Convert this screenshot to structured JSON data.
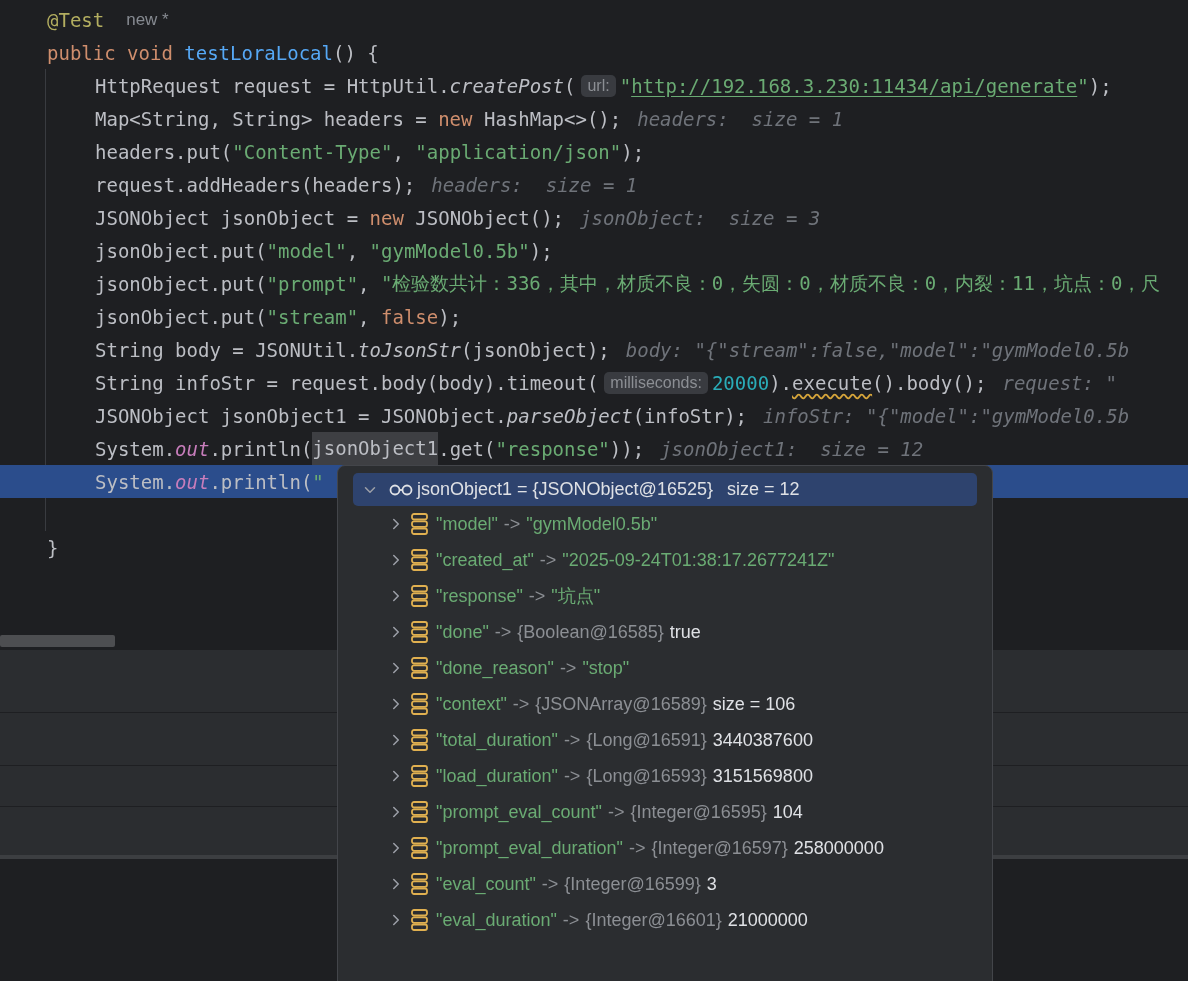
{
  "code": {
    "lines": [
      {
        "current": false,
        "tokens": [
          {
            "text": "@Test",
            "kind": "annotation"
          },
          {
            "text": "new *",
            "kind": "vision"
          }
        ]
      },
      {
        "current": false,
        "tokens": [
          {
            "text": "public void ",
            "kind": "keyword"
          },
          {
            "text": "testLoraLocal",
            "kind": "method"
          },
          {
            "text": "() {",
            "kind": "plain"
          }
        ],
        "children": [
          {
            "current": false,
            "tokens": [
              {
                "text": "HttpRequest request = HttpUtil.",
                "kind": "plain"
              },
              {
                "text": "createPost",
                "kind": "italic"
              },
              {
                "text": "(",
                "kind": "plain"
              },
              {
                "text": "url:",
                "kind": "param"
              },
              {
                "text": "\"",
                "kind": "string"
              },
              {
                "text": "http://192.168.3.230:11434/api/generate",
                "kind": "link"
              },
              {
                "text": "\"",
                "kind": "string"
              },
              {
                "text": ");",
                "kind": "plain"
              }
            ]
          },
          {
            "current": false,
            "tokens": [
              {
                "text": "Map<String, String> headers = ",
                "kind": "plain"
              },
              {
                "text": "new",
                "kind": "keyword"
              },
              {
                "text": " HashMap<>();",
                "kind": "plain"
              },
              {
                "text": "headers:  size = 1",
                "kind": "hint"
              }
            ]
          },
          {
            "current": false,
            "tokens": [
              {
                "text": "headers.put(",
                "kind": "plain"
              },
              {
                "text": "\"Content-Type\"",
                "kind": "string"
              },
              {
                "text": ", ",
                "kind": "plain"
              },
              {
                "text": "\"application/json\"",
                "kind": "string"
              },
              {
                "text": ");",
                "kind": "plain"
              }
            ]
          },
          {
            "current": false,
            "tokens": [
              {
                "text": "request.addHeaders(headers);",
                "kind": "plain"
              },
              {
                "text": "headers:  size = 1",
                "kind": "hint"
              }
            ]
          },
          {
            "current": false,
            "tokens": [
              {
                "text": "JSONObject jsonObject = ",
                "kind": "plain"
              },
              {
                "text": "new",
                "kind": "keyword"
              },
              {
                "text": " JSONObject();",
                "kind": "plain"
              },
              {
                "text": "jsonObject:  size = 3",
                "kind": "hint"
              }
            ]
          },
          {
            "current": false,
            "tokens": [
              {
                "text": "jsonObject.put(",
                "kind": "plain"
              },
              {
                "text": "\"model\"",
                "kind": "string"
              },
              {
                "text": ", ",
                "kind": "plain"
              },
              {
                "text": "\"gymModel0.5b\"",
                "kind": "string"
              },
              {
                "text": ");",
                "kind": "plain"
              }
            ]
          },
          {
            "current": false,
            "tokens": [
              {
                "text": "jsonObject.put(",
                "kind": "plain"
              },
              {
                "text": "\"prompt\"",
                "kind": "string"
              },
              {
                "text": ", ",
                "kind": "plain"
              },
              {
                "text": "\"检验数共计：336，其中，材质不良：0，失圆：0，材质不良：0，内裂：11，坑点：0，尺",
                "kind": "string"
              }
            ]
          },
          {
            "current": false,
            "tokens": [
              {
                "text": "jsonObject.put(",
                "kind": "plain"
              },
              {
                "text": "\"stream\"",
                "kind": "string"
              },
              {
                "text": ", ",
                "kind": "plain"
              },
              {
                "text": "false",
                "kind": "keyword"
              },
              {
                "text": ");",
                "kind": "plain"
              }
            ]
          },
          {
            "current": false,
            "tokens": [
              {
                "text": "String body = JSONUtil.",
                "kind": "plain"
              },
              {
                "text": "toJsonStr",
                "kind": "italic"
              },
              {
                "text": "(jsonObject);",
                "kind": "plain"
              },
              {
                "text": "body: \"{\"stream\":false,\"model\":\"gymModel0.5b",
                "kind": "hint"
              }
            ]
          },
          {
            "current": false,
            "tokens": [
              {
                "text": "String infoStr = request.body(body).timeout(",
                "kind": "plain"
              },
              {
                "text": "milliseconds:",
                "kind": "param"
              },
              {
                "text": "20000",
                "kind": "number"
              },
              {
                "text": ").",
                "kind": "plain"
              },
              {
                "text": "execute",
                "kind": "warning"
              },
              {
                "text": "().body();",
                "kind": "plain"
              },
              {
                "text": "request: \"",
                "kind": "hint"
              }
            ]
          },
          {
            "current": false,
            "tokens": [
              {
                "text": "JSONObject jsonObject1 = JSONObject.",
                "kind": "plain"
              },
              {
                "text": "parseObject",
                "kind": "italic"
              },
              {
                "text": "(infoStr);",
                "kind": "plain"
              },
              {
                "text": "infoStr: \"{\"model\":\"gymModel0.5b",
                "kind": "hint"
              }
            ]
          },
          {
            "current": false,
            "tokens": [
              {
                "text": "System.",
                "kind": "plain"
              },
              {
                "text": "out",
                "kind": "field"
              },
              {
                "text": ".println(",
                "kind": "plain"
              },
              {
                "text": "jsonObject1",
                "kind": "reference"
              },
              {
                "text": ".get(",
                "kind": "plain"
              },
              {
                "text": "\"response\"",
                "kind": "string"
              },
              {
                "text": "));",
                "kind": "plain"
              },
              {
                "text": "jsonObject1:  size = 12",
                "kind": "hint"
              }
            ]
          },
          {
            "current": true,
            "tokens": [
              {
                "text": "System.",
                "kind": "plain"
              },
              {
                "text": "out",
                "kind": "field"
              },
              {
                "text": ".println(",
                "kind": "plain"
              },
              {
                "text": "\"",
                "kind": "string"
              }
            ]
          },
          {
            "current": false
          }
        ]
      },
      {
        "current": false,
        "tokens": [
          {
            "text": "}",
            "kind": "plain"
          }
        ]
      }
    ]
  },
  "debugger_popup": {
    "root": {
      "name": "jsonObject1",
      "value": "= {JSONObject@16525}",
      "extra": "size = 12",
      "expanded": true,
      "selected": true,
      "children": [
        {
          "kind": "string",
          "key": "\"model\"",
          "arrow": "->",
          "value": "\"gymModel0.5b\"",
          "expanded": false
        },
        {
          "kind": "string",
          "key": "\"created_at\"",
          "arrow": "->",
          "value": "\"2025-09-24T01:38:17.2677241Z\"",
          "expanded": false
        },
        {
          "kind": "string",
          "key": "\"response\"",
          "arrow": "->",
          "value": "\"坑点\"",
          "expanded": false
        },
        {
          "kind": "object",
          "key": "\"done\"",
          "arrow": "->",
          "type": "{Boolean@16585}",
          "value": "true",
          "expanded": false
        },
        {
          "kind": "string",
          "key": "\"done_reason\"",
          "arrow": "->",
          "value": "\"stop\"",
          "expanded": false
        },
        {
          "kind": "object",
          "key": "\"context\"",
          "arrow": "->",
          "type": "{JSONArray@16589}",
          "value": "size = 106",
          "expanded": false
        },
        {
          "kind": "object",
          "key": "\"total_duration\"",
          "arrow": "->",
          "type": "{Long@16591}",
          "value": "3440387600",
          "expanded": false
        },
        {
          "kind": "object",
          "key": "\"load_duration\"",
          "arrow": "->",
          "type": "{Long@16593}",
          "value": "3151569800",
          "expanded": false
        },
        {
          "kind": "object",
          "key": "\"prompt_eval_count\"",
          "arrow": "->",
          "type": "{Integer@16595}",
          "value": "104",
          "expanded": false
        },
        {
          "kind": "object",
          "key": "\"prompt_eval_duration\"",
          "arrow": "->",
          "type": "{Integer@16597}",
          "value": "258000000",
          "expanded": false
        },
        {
          "kind": "object",
          "key": "\"eval_count\"",
          "arrow": "->",
          "type": "{Integer@16599}",
          "value": "3",
          "expanded": false
        },
        {
          "kind": "object",
          "key": "\"eval_duration\"",
          "arrow": "->",
          "type": "{Integer@16601}",
          "value": "21000000",
          "expanded": false
        }
      ]
    }
  }
}
